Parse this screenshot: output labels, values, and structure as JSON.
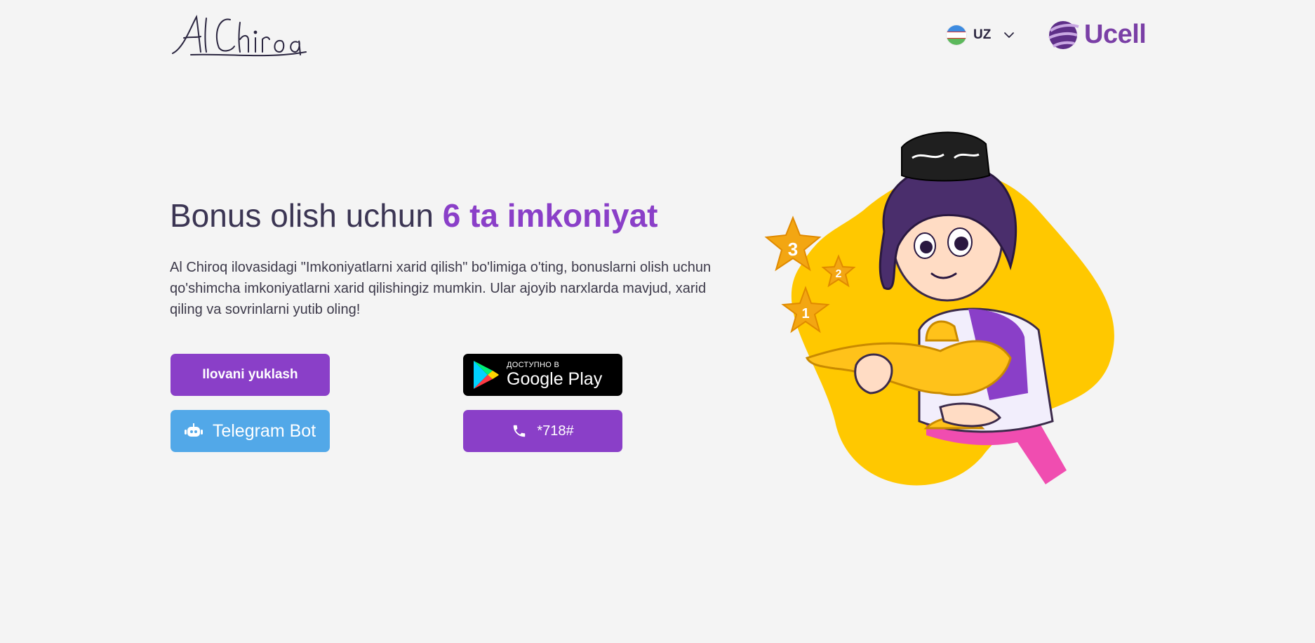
{
  "header": {
    "logo_alt": "Al Chiroq",
    "language": {
      "code": "UZ"
    },
    "brand": {
      "name": "Ucell"
    }
  },
  "hero": {
    "title_main": "Bonus olish uchun ",
    "title_accent": "6 ta imkoniyat",
    "description": "Al Chiroq ilovasidagi \"Imkoniyatlarni xarid qilish\" bo'limiga o'ting, bonuslarni olish uchun qo'shimcha imkoniyatlarni xarid qilishingiz mumkin. Ular ajoyib narxlarda mavjud, xarid qiling va sovrinlarni yutib oling!"
  },
  "buttons": {
    "download_label": "Ilovani yuklash",
    "gplay_small": "ДОСТУПНО В",
    "gplay_big": "Google Play",
    "telegram_label": "Telegram Bot",
    "call_label": "*718#"
  },
  "illustration": {
    "stars": [
      "3",
      "2",
      "1"
    ]
  },
  "colors": {
    "accent": "#8a3fc8",
    "telegram": "#52a8e8",
    "brand": "#7a3fa6",
    "blob": "#ffc800"
  }
}
